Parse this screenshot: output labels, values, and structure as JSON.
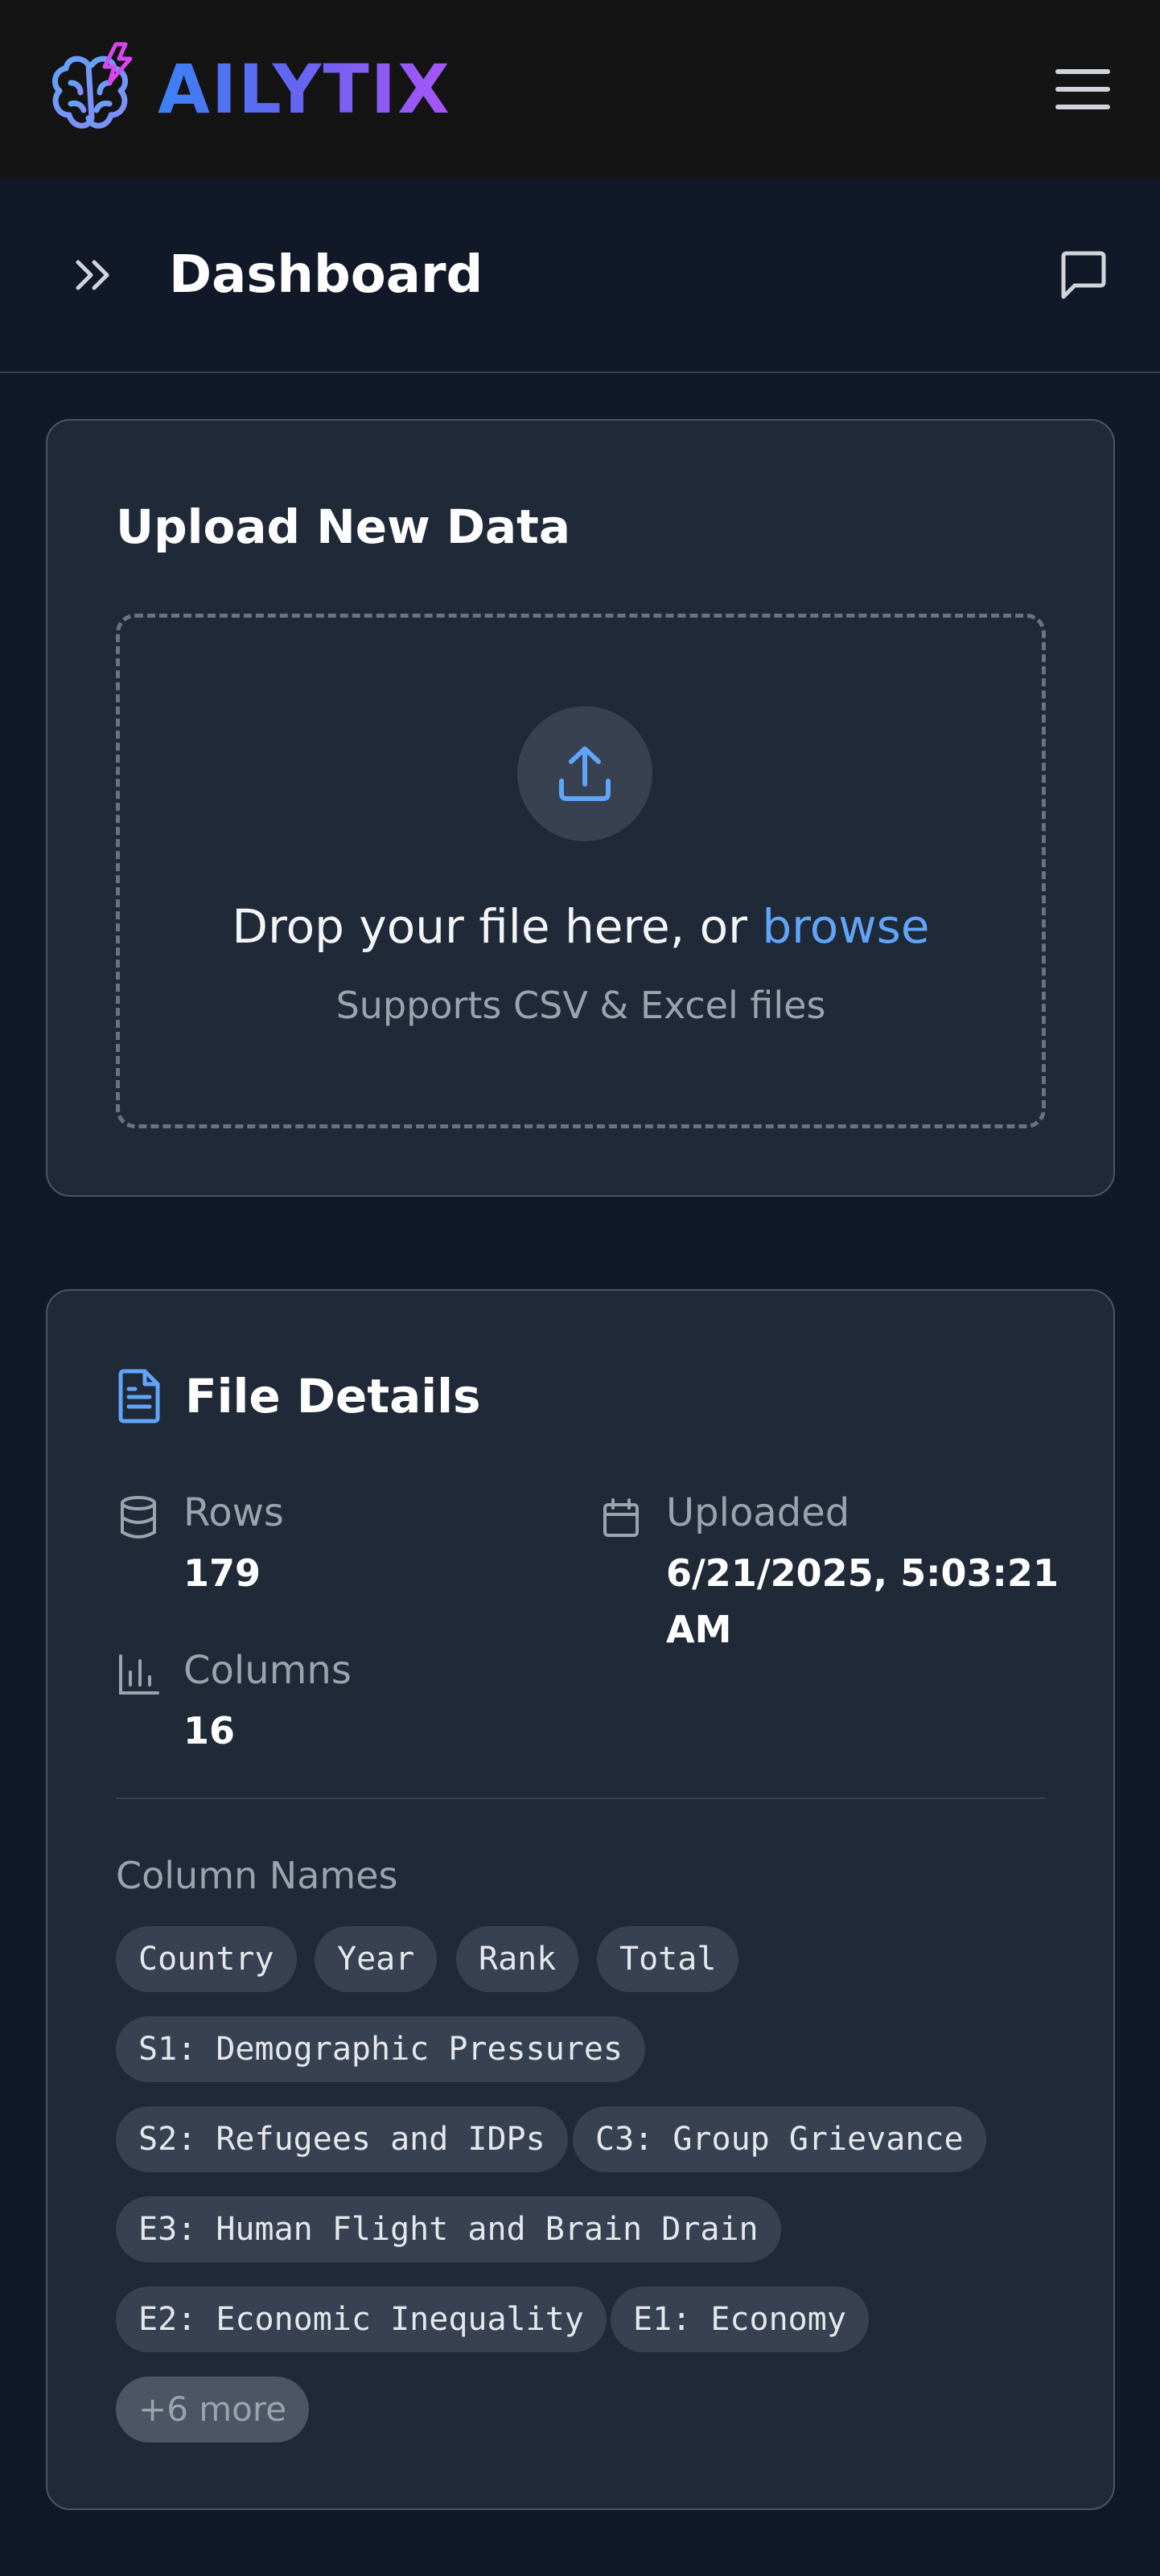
{
  "navbar": {
    "brand": "AILYTIX",
    "logo_icon": "brain-bolt-icon",
    "menu_icon": "hamburger-menu-icon"
  },
  "header": {
    "title": "Dashboard",
    "expand_icon": "chevrons-right-icon",
    "chat_icon": "message-square-icon"
  },
  "upload": {
    "title": "Upload New Data",
    "icon": "upload-icon",
    "drop_text": "Drop your file here, or",
    "browse_text": "browse",
    "supported_text": "Supports CSV & Excel files"
  },
  "file_details": {
    "title": "File Details",
    "icon": "file-text-icon",
    "rows_label": "Rows",
    "rows_value": "179",
    "uploaded_label": "Uploaded",
    "uploaded_value": "6/21/2025, 5:03:21 AM",
    "columns_label": "Columns",
    "columns_value": "16",
    "column_names_label": "Column Names",
    "columns": [
      "Country",
      "Year",
      "Rank",
      "Total",
      "S1: Demographic Pressures",
      "S2: Refugees and IDPs",
      "C3: Group Grievance",
      "E3: Human Flight and Brain Drain",
      "E2: Economic Inequality",
      "E1: Economy"
    ],
    "more_label": "+6 more"
  },
  "colors": {
    "background": "#111827",
    "navbar": "#141414",
    "card": "#1f2937",
    "accent": "#60a5fa",
    "brand_gradient_start": "#3b82f6",
    "brand_gradient_end": "#a855f7"
  }
}
